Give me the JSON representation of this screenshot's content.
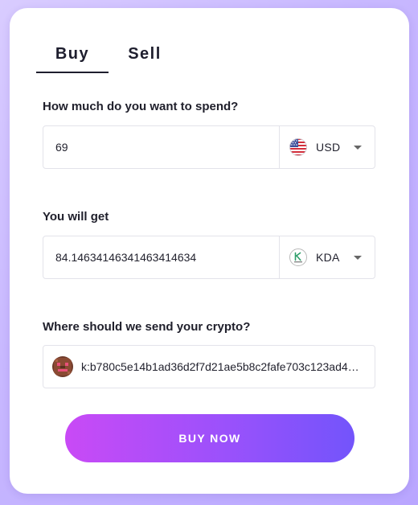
{
  "tabs": [
    {
      "label": "Buy",
      "active": true
    },
    {
      "label": "Sell",
      "active": false
    }
  ],
  "spend": {
    "label": "How much do you want to spend?",
    "amount": "69",
    "currency": "USD",
    "currency_icon": "us-flag-icon"
  },
  "receive": {
    "label": "You will get",
    "amount": "84.14634146341463414634",
    "currency": "KDA",
    "currency_icon": "kda-logo-icon"
  },
  "wallet": {
    "label": "Where should we send your crypto?",
    "address": "k:b780c5e14b1ad36d2f7d21ae5b8c2fafe703c123ad4…",
    "avatar_icon": "wallet-avatar-icon"
  },
  "buy_button": {
    "label": "BUY NOW"
  },
  "colors": {
    "background": "#c8b8ff",
    "button_start": "#c94af6",
    "button_end": "#7354fb",
    "text": "#1e1e2e",
    "border": "#e3e3ea"
  }
}
